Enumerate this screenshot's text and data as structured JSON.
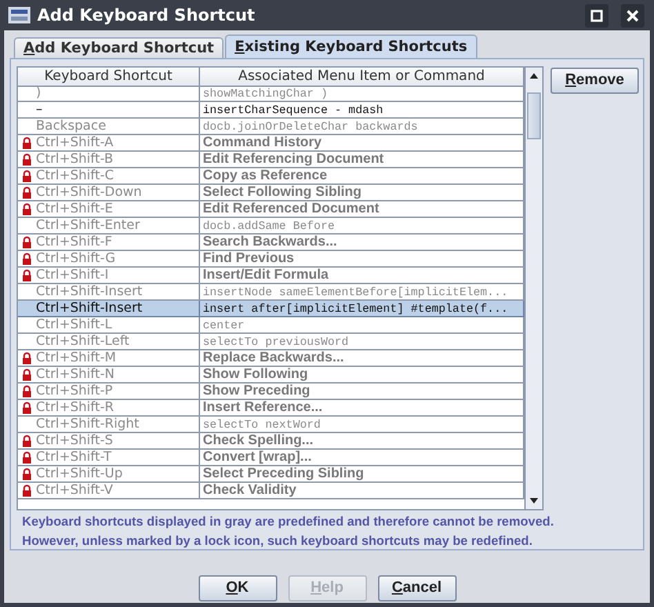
{
  "window": {
    "title": "Add Keyboard Shortcut"
  },
  "tabs": [
    {
      "label": "Add Keyboard Shortcut",
      "selected": false,
      "mnemonic": true
    },
    {
      "label": "Existing Keyboard Shortcuts",
      "selected": true,
      "mnemonic": true
    }
  ],
  "table": {
    "columns": [
      "Keyboard Shortcut",
      "Associated Menu Item or Command"
    ],
    "rows": [
      {
        "shortcut": ")",
        "command": "showMatchingChar )",
        "kind": "command",
        "locked": false,
        "predefined": true,
        "selected": false
      },
      {
        "shortcut": "–",
        "command": "insertCharSequence - mdash",
        "kind": "command",
        "locked": false,
        "predefined": false,
        "selected": false
      },
      {
        "shortcut": "Backspace",
        "command": "docb.joinOrDeleteChar backwards",
        "kind": "command",
        "locked": false,
        "predefined": true,
        "selected": false
      },
      {
        "shortcut": "Ctrl+Shift-A",
        "command": "Command History",
        "kind": "menu",
        "locked": true,
        "predefined": true,
        "selected": false
      },
      {
        "shortcut": "Ctrl+Shift-B",
        "command": "Edit Referencing Document",
        "kind": "menu",
        "locked": true,
        "predefined": true,
        "selected": false
      },
      {
        "shortcut": "Ctrl+Shift-C",
        "command": "Copy as Reference",
        "kind": "menu",
        "locked": true,
        "predefined": true,
        "selected": false
      },
      {
        "shortcut": "Ctrl+Shift-Down",
        "command": "Select Following Sibling",
        "kind": "menu",
        "locked": true,
        "predefined": true,
        "selected": false
      },
      {
        "shortcut": "Ctrl+Shift-E",
        "command": "Edit Referenced Document",
        "kind": "menu",
        "locked": true,
        "predefined": true,
        "selected": false
      },
      {
        "shortcut": "Ctrl+Shift-Enter",
        "command": "docb.addSame Before",
        "kind": "command",
        "locked": false,
        "predefined": true,
        "selected": false
      },
      {
        "shortcut": "Ctrl+Shift-F",
        "command": "Search Backwards...",
        "kind": "menu",
        "locked": true,
        "predefined": true,
        "selected": false
      },
      {
        "shortcut": "Ctrl+Shift-G",
        "command": "Find Previous",
        "kind": "menu",
        "locked": true,
        "predefined": true,
        "selected": false
      },
      {
        "shortcut": "Ctrl+Shift-I",
        "command": "Insert/Edit Formula",
        "kind": "menu",
        "locked": true,
        "predefined": true,
        "selected": false
      },
      {
        "shortcut": "Ctrl+Shift-Insert",
        "command": "insertNode sameElementBefore[implicitElem...",
        "kind": "command",
        "locked": false,
        "predefined": true,
        "selected": false
      },
      {
        "shortcut": "Ctrl+Shift-Insert",
        "command": "insert after[implicitElement] #template(f...",
        "kind": "command",
        "locked": false,
        "predefined": false,
        "selected": true
      },
      {
        "shortcut": "Ctrl+Shift-L",
        "command": "center",
        "kind": "command",
        "locked": false,
        "predefined": true,
        "selected": false
      },
      {
        "shortcut": "Ctrl+Shift-Left",
        "command": "selectTo previousWord",
        "kind": "command",
        "locked": false,
        "predefined": true,
        "selected": false
      },
      {
        "shortcut": "Ctrl+Shift-M",
        "command": "Replace Backwards...",
        "kind": "menu",
        "locked": true,
        "predefined": true,
        "selected": false
      },
      {
        "shortcut": "Ctrl+Shift-N",
        "command": "Show Following",
        "kind": "menu",
        "locked": true,
        "predefined": true,
        "selected": false
      },
      {
        "shortcut": "Ctrl+Shift-P",
        "command": "Show Preceding",
        "kind": "menu",
        "locked": true,
        "predefined": true,
        "selected": false
      },
      {
        "shortcut": "Ctrl+Shift-R",
        "command": "Insert Reference...",
        "kind": "menu",
        "locked": true,
        "predefined": true,
        "selected": false
      },
      {
        "shortcut": "Ctrl+Shift-Right",
        "command": "selectTo nextWord",
        "kind": "command",
        "locked": false,
        "predefined": true,
        "selected": false
      },
      {
        "shortcut": "Ctrl+Shift-S",
        "command": "Check Spelling...",
        "kind": "menu",
        "locked": true,
        "predefined": true,
        "selected": false
      },
      {
        "shortcut": "Ctrl+Shift-T",
        "command": "Convert [wrap]...",
        "kind": "menu",
        "locked": true,
        "predefined": true,
        "selected": false
      },
      {
        "shortcut": "Ctrl+Shift-Up",
        "command": "Select Preceding Sibling",
        "kind": "menu",
        "locked": true,
        "predefined": true,
        "selected": false
      },
      {
        "shortcut": "Ctrl+Shift-V",
        "command": "Check Validity",
        "kind": "menu",
        "locked": true,
        "predefined": true,
        "selected": false
      }
    ]
  },
  "remove_button": {
    "label": "Remove",
    "mnemonic": true
  },
  "note": [
    "Keyboard shortcuts displayed in gray are predefined and therefore cannot be removed.",
    "However, unless  marked by a lock icon, such keyboard shortcuts  may be redefined."
  ],
  "buttons": [
    {
      "label": "OK",
      "mnemonic": true,
      "disabled": false
    },
    {
      "label": "Help",
      "mnemonic": true,
      "disabled": true
    },
    {
      "label": "Cancel",
      "mnemonic": true,
      "disabled": false
    }
  ]
}
